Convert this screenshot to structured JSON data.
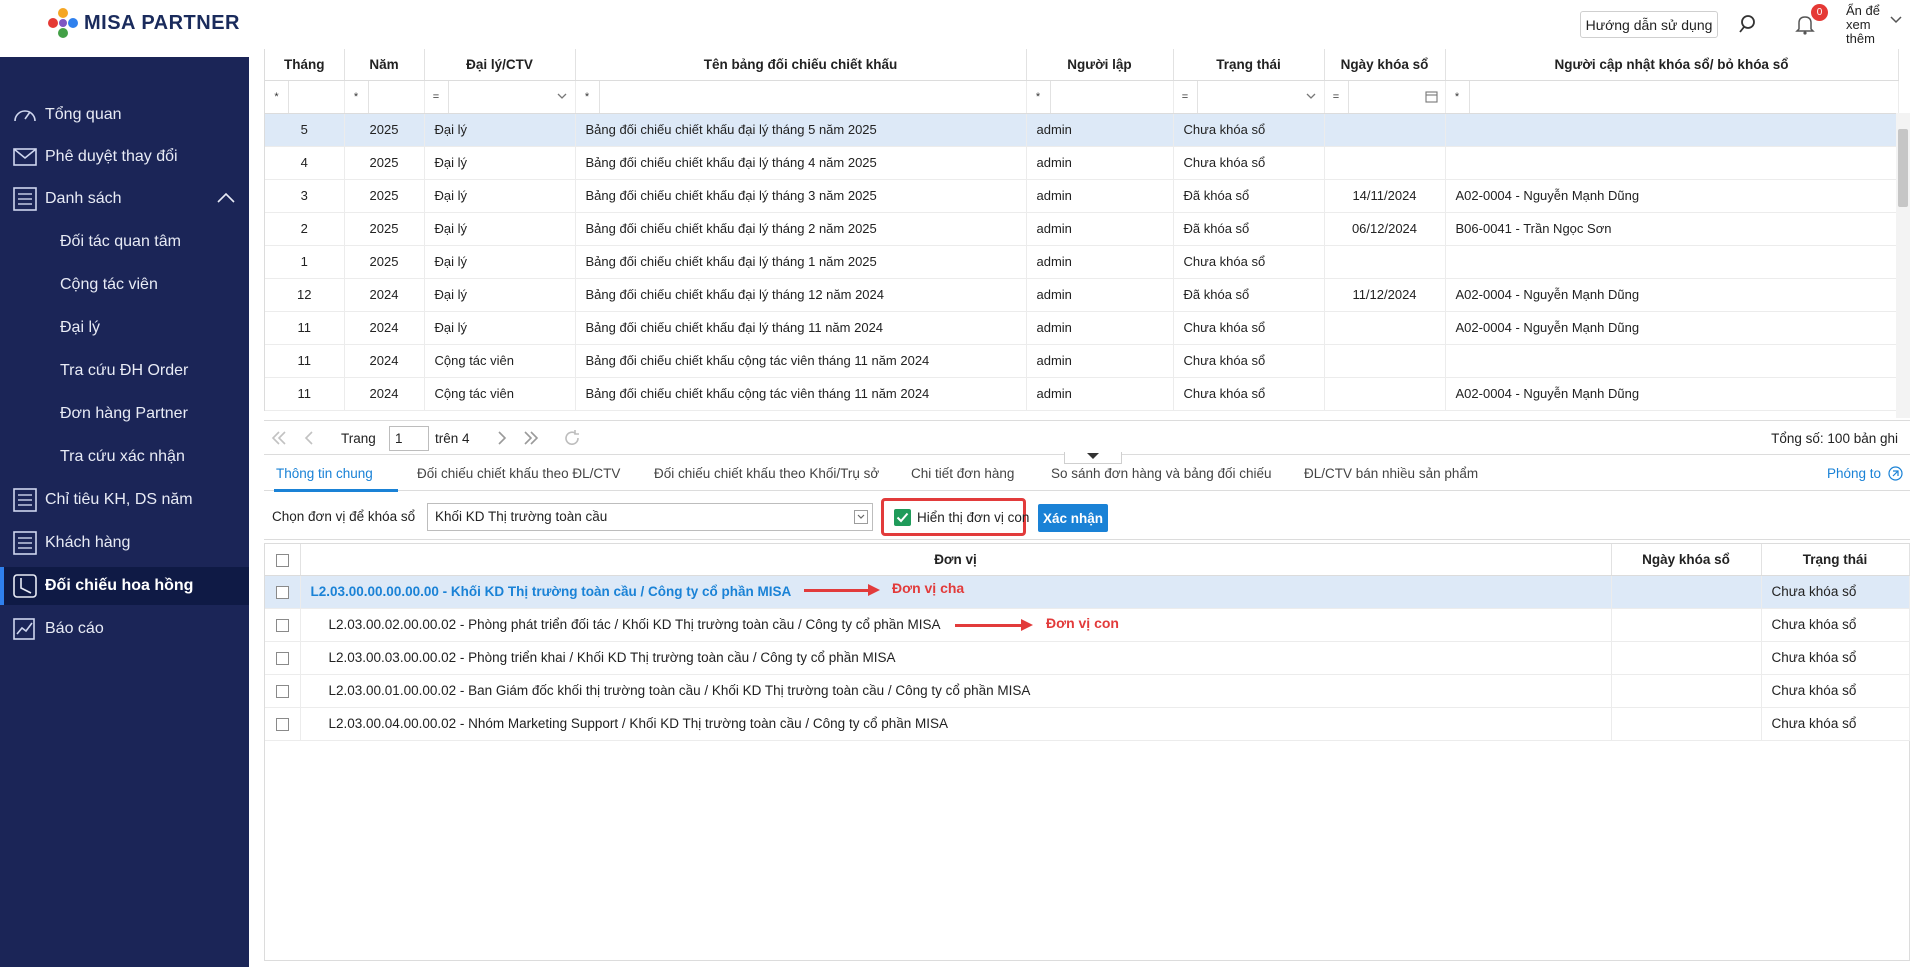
{
  "header": {
    "brand": "MISA PARTNER",
    "help_label": "Hướng dẫn sử dụng",
    "notif_count": "0",
    "user_text": "Ẩn để xem thêm"
  },
  "sidebar": {
    "items": [
      {
        "label": "Tổng quan",
        "icon": "dashboard-icon"
      },
      {
        "label": "Phê duyệt thay đổi",
        "icon": "mail-icon"
      },
      {
        "label": "Danh sách",
        "icon": "list-icon"
      },
      {
        "label": "Đối tác quan tâm"
      },
      {
        "label": "Cộng tác viên"
      },
      {
        "label": "Đại lý"
      },
      {
        "label": "Tra cứu ĐH Order"
      },
      {
        "label": "Đơn hàng Partner"
      },
      {
        "label": "Tra cứu xác nhận"
      },
      {
        "label": "Chỉ tiêu KH, DS năm",
        "icon": "list-icon"
      },
      {
        "label": "Khách hàng",
        "icon": "list-icon"
      },
      {
        "label": "Đối chiếu hoa hồng",
        "icon": "clock-icon"
      },
      {
        "label": "Báo cáo",
        "icon": "report-icon"
      }
    ]
  },
  "top_grid": {
    "columns": [
      "Tháng",
      "Năm",
      "Đại lý/CTV",
      "Tên bảng đối chiếu chiết khấu",
      "Người lập",
      "Trạng thái",
      "Ngày khóa sổ",
      "Người cập nhật khóa sổ/ bỏ khóa sổ"
    ],
    "filter_ops": [
      "*",
      "*",
      "=",
      "*",
      "*",
      "=",
      "=",
      "*"
    ],
    "rows": [
      [
        "5",
        "2025",
        "Đại lý",
        "Bảng đối chiếu chiết khấu đại lý tháng 5 năm 2025",
        "admin",
        "Chưa khóa sổ",
        "",
        ""
      ],
      [
        "4",
        "2025",
        "Đại lý",
        "Bảng đối chiếu chiết khấu đại lý tháng 4 năm 2025",
        "admin",
        "Chưa khóa sổ",
        "",
        ""
      ],
      [
        "3",
        "2025",
        "Đại lý",
        "Bảng đối chiếu chiết khấu đại lý tháng 3 năm 2025",
        "admin",
        "Đã khóa sổ",
        "14/11/2024",
        "A02-0004 - Nguyễn Mạnh Dũng"
      ],
      [
        "2",
        "2025",
        "Đại lý",
        "Bảng đối chiếu chiết khấu đại lý tháng 2 năm 2025",
        "admin",
        "Đã khóa sổ",
        "06/12/2024",
        "B06-0041 - Trần Ngọc Sơn"
      ],
      [
        "1",
        "2025",
        "Đại lý",
        "Bảng đối chiếu chiết khấu đại lý tháng 1 năm 2025",
        "admin",
        "Chưa khóa sổ",
        "",
        ""
      ],
      [
        "12",
        "2024",
        "Đại lý",
        "Bảng đối chiếu chiết khấu đại lý tháng 12 năm 2024",
        "admin",
        "Đã khóa sổ",
        "11/12/2024",
        "A02-0004 - Nguyễn Mạnh Dũng"
      ],
      [
        "11",
        "2024",
        "Đại lý",
        "Bảng đối chiếu chiết khấu đại lý tháng 11 năm 2024",
        "admin",
        "Chưa khóa sổ",
        "",
        "A02-0004 - Nguyễn Mạnh Dũng"
      ],
      [
        "11",
        "2024",
        "Cộng tác viên",
        "Bảng đối chiếu chiết khấu cộng tác viên tháng 11 năm 2024",
        "admin",
        "Chưa khóa sổ",
        "",
        ""
      ],
      [
        "11",
        "2024",
        "Cộng tác viên",
        "Bảng đối chiếu chiết khấu cộng tác viên tháng 11 năm 2024",
        "admin",
        "Chưa khóa sổ",
        "",
        "A02-0004 - Nguyễn Mạnh Dũng"
      ]
    ]
  },
  "pager": {
    "page_label": "Trang",
    "page_value": "1",
    "of_label": "trên 4",
    "total_label": "Tổng số: 100 bản ghi"
  },
  "tabs": {
    "items": [
      "Thông tin chung",
      "Đối chiếu chiết khấu theo ĐL/CTV",
      "Đối chiếu chiết khấu theo Khối/Trụ sở",
      "Chi tiết đơn hàng",
      "So sánh đơn hàng và bảng đối chiếu",
      "ĐL/CTV bán nhiều sản phẩm"
    ],
    "zoom_label": "Phóng to"
  },
  "unit_filter": {
    "label": "Chọn đơn vị để khóa sổ",
    "selected": "Khối KD Thị trường toàn cầu",
    "show_child_label": "Hiển thị đơn vị con",
    "confirm_label": "Xác nhận"
  },
  "bottom_grid": {
    "columns": [
      "Đơn vị",
      "Ngày khóa sổ",
      "Trạng thái"
    ],
    "rows": [
      [
        "L2.03.00.00.00.00.00 - Khối KD Thị trường toàn cầu / Công ty cổ phần MISA",
        "",
        "Chưa khóa sổ"
      ],
      [
        "L2.03.00.02.00.00.02 - Phòng phát triển đối tác / Khối KD Thị trường toàn cầu / Công ty cổ phần MISA",
        "",
        "Chưa khóa sổ"
      ],
      [
        "L2.03.00.03.00.00.02 - Phòng triển khai / Khối KD Thị trường toàn cầu / Công ty cổ phần MISA",
        "",
        "Chưa khóa sổ"
      ],
      [
        "L2.03.00.01.00.00.02 - Ban Giám đốc khối thị trường toàn cầu / Khối KD Thị trường toàn cầu / Công ty cổ phần MISA",
        "",
        "Chưa khóa sổ"
      ],
      [
        "L2.03.00.04.00.00.02 - Nhóm Marketing Support / Khối KD Thị trường toàn cầu / Công ty cổ phần MISA",
        "",
        "Chưa khóa sổ"
      ]
    ]
  },
  "annotations": {
    "parent_label": "Đơn vị cha",
    "child_label": "Đơn vị con"
  },
  "colors": {
    "sidebar_bg": "#1b2557",
    "accent": "#1a82d6",
    "highlight_red": "#e23b3b",
    "check_green": "#1f9b5a"
  }
}
